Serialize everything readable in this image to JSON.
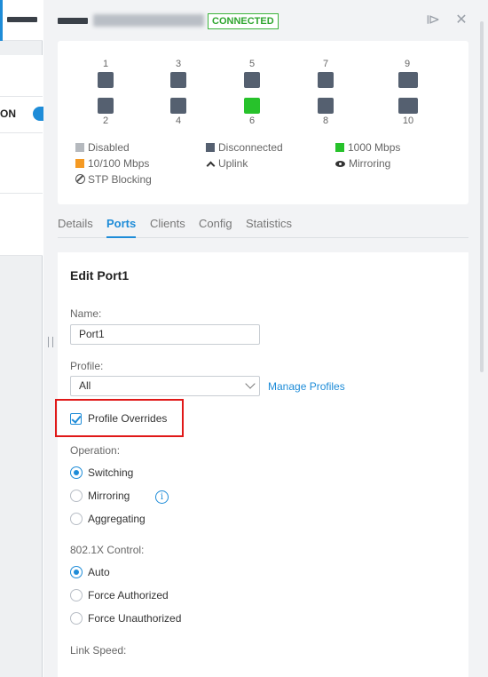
{
  "left_panel": {
    "truncated_label": "ON"
  },
  "header": {
    "status": "CONNECTED",
    "status_color": "#2ea52e",
    "buttons": [
      {
        "name": "collapse-drawer-icon",
        "glyph": "⧐"
      },
      {
        "name": "close-icon",
        "glyph": "✕"
      }
    ]
  },
  "ports": {
    "top": [
      "1",
      "3",
      "5",
      "7",
      "9"
    ],
    "bottom": [
      "2",
      "4",
      "6",
      "8",
      "10"
    ],
    "active_port": "6",
    "colors": {
      "disconnected": "#556070",
      "active": "#27c22b"
    }
  },
  "legend": {
    "disabled": "Disabled",
    "disconnected": "Disconnected",
    "gbps": "1000 Mbps",
    "mbps": "10/100 Mbps",
    "uplink": "Uplink",
    "mirroring": "Mirroring",
    "stp": "STP Blocking",
    "colors": {
      "disabled": "#b5b9be",
      "disconnected": "#556070",
      "gbps": "#27c22b",
      "mbps": "#f59a23"
    }
  },
  "tabs": [
    {
      "label": "Details",
      "active": false
    },
    {
      "label": "Ports",
      "active": true
    },
    {
      "label": "Clients",
      "active": false
    },
    {
      "label": "Config",
      "active": false
    },
    {
      "label": "Statistics",
      "active": false
    }
  ],
  "form": {
    "title": "Edit Port1",
    "name_label": "Name:",
    "name_value": "Port1",
    "profile_label": "Profile:",
    "profile_value": "All",
    "manage_profiles": "Manage Profiles",
    "profile_overrides": "Profile Overrides",
    "profile_overrides_checked": true,
    "operation_label": "Operation:",
    "operation_options": [
      "Switching",
      "Mirroring",
      "Aggregating"
    ],
    "operation_selected": "Switching",
    "dot1x_label": "802.1X Control:",
    "dot1x_options": [
      "Auto",
      "Force Authorized",
      "Force Unauthorized"
    ],
    "dot1x_selected": "Auto",
    "link_speed_label": "Link Speed:"
  }
}
